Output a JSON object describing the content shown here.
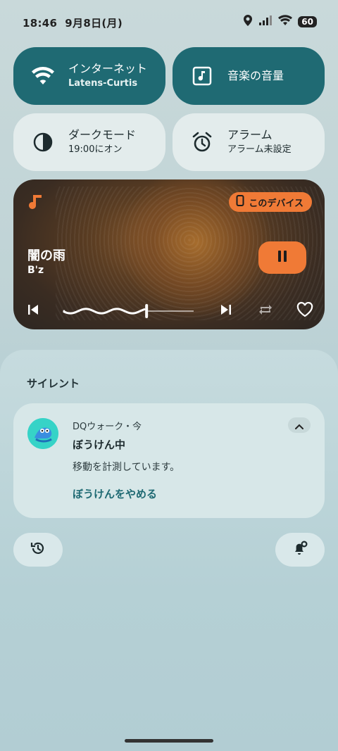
{
  "status_bar": {
    "time": "18:46",
    "date": "9月8日(月)",
    "battery": "60"
  },
  "tiles": [
    {
      "title": "インターネット",
      "subtitle": "Latens-Curtis",
      "icon": "wifi-icon"
    },
    {
      "title": "音楽の音量",
      "subtitle": "",
      "icon": "music-note-icon"
    },
    {
      "title": "ダークモード",
      "subtitle": "19:00にオン",
      "icon": "dark-mode-icon"
    },
    {
      "title": "アラーム",
      "subtitle": "アラーム未設定",
      "icon": "alarm-icon"
    }
  ],
  "media": {
    "device": "このデバイス",
    "title": "闇の雨",
    "artist": "B'z",
    "progress": 0.63,
    "accent": "#f07a36"
  },
  "notifications": {
    "section_title": "サイレント",
    "items": [
      {
        "app": "DQウォーク・今",
        "title": "ぼうけん中",
        "text": "移動を計測しています。",
        "action": "ぼうけんをやめる"
      }
    ]
  }
}
